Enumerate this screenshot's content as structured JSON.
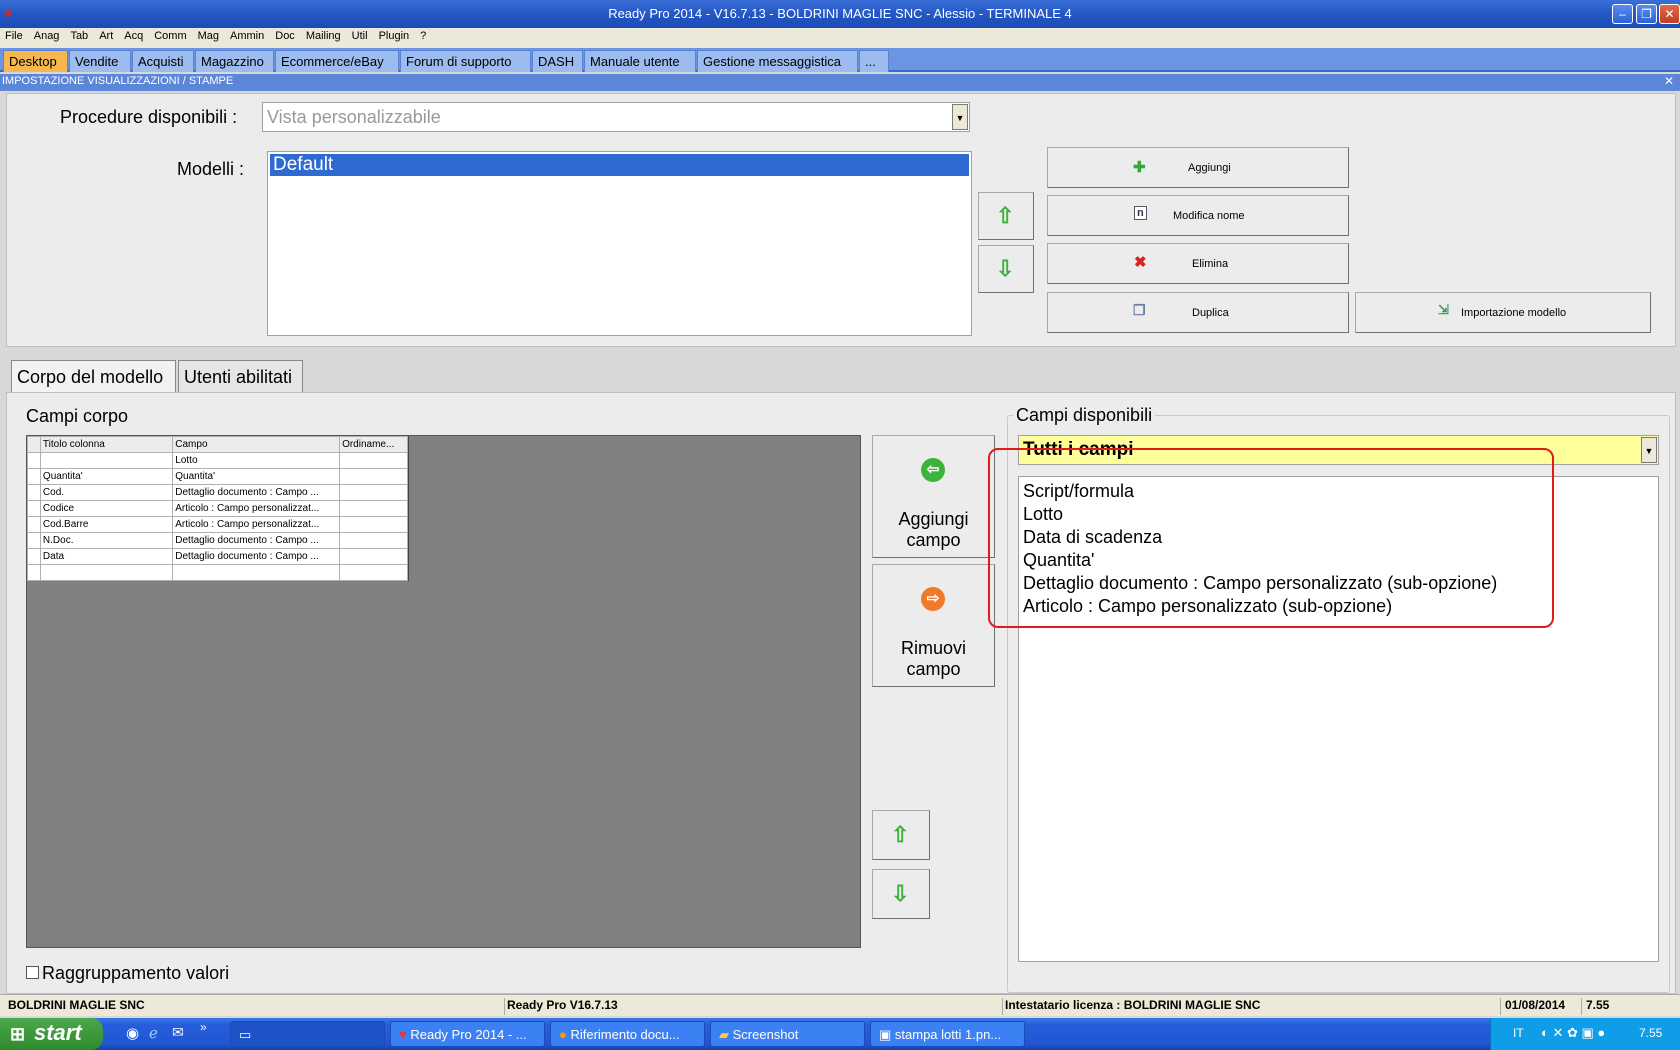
{
  "window": {
    "title": "Ready Pro 2014 - V16.7.13 - BOLDRINI MAGLIE SNC - Alessio - TERMINALE 4",
    "minimize": "–",
    "restore": "❐",
    "close": "✕"
  },
  "menu": [
    "File",
    "Anag",
    "Tab",
    "Art",
    "Acq",
    "Comm",
    "Mag",
    "Ammin",
    "Doc",
    "Mailing",
    "Util",
    "Plugin",
    "?"
  ],
  "app_tabs": [
    "Desktop",
    "Vendite",
    "Acquisti",
    "Magazzino",
    "Ecommerce/eBay",
    "Forum di supporto",
    "DASH",
    "Manuale utente",
    "Gestione messaggistica",
    "..."
  ],
  "panel": {
    "title": "IMPOSTAZIONE VISUALIZZAZIONI / STAMPE",
    "close": "✕"
  },
  "procedure": {
    "label": "Procedure disponibili :",
    "value": "Vista personalizzabile"
  },
  "modelli": {
    "label": "Modelli :",
    "items": [
      "Default"
    ]
  },
  "buttons": {
    "aggiungi": "Aggiungi",
    "modifica_nome": "Modifica nome",
    "elimina": "Elimina",
    "duplica": "Duplica",
    "importazione": "Importazione modello",
    "aggiungi_campo": "Aggiungi campo",
    "rimuovi_campo": "Rimuovi campo"
  },
  "sub_tabs": [
    "Corpo del modello",
    "Utenti abilitati"
  ],
  "campi_corpo": {
    "label": "Campi corpo",
    "columns": [
      "Titolo colonna",
      "Campo",
      "Ordiname..."
    ],
    "rows": [
      [
        "",
        "Lotto",
        ""
      ],
      [
        "Quantita'",
        "Quantita'",
        ""
      ],
      [
        "Cod.",
        "Dettaglio documento : Campo ...",
        ""
      ],
      [
        "Codice",
        "Articolo : Campo personalizzat...",
        ""
      ],
      [
        "Cod.Barre",
        "Articolo : Campo personalizzat...",
        ""
      ],
      [
        "N.Doc.",
        "Dettaglio documento : Campo ...",
        ""
      ],
      [
        "Data",
        "Dettaglio documento : Campo ...",
        ""
      ],
      [
        "",
        "",
        ""
      ]
    ]
  },
  "campi_disponibili": {
    "label": "Campi disponibili",
    "filter": "Tutti i campi",
    "items": [
      "Script/formula",
      "Lotto",
      "Data di scadenza",
      "Quantita'",
      "Dettaglio documento : Campo personalizzato (sub-opzione)",
      "Articolo : Campo personalizzato (sub-opzione)"
    ]
  },
  "raggruppamento": {
    "label": "Raggruppamento valori",
    "checked": false
  },
  "status": {
    "company": "BOLDRINI MAGLIE SNC",
    "version": "Ready Pro V16.7.13",
    "license": "Intestatario licenza : BOLDRINI MAGLIE SNC",
    "date": "01/08/2014",
    "time": "7.55"
  },
  "taskbar": {
    "start": "start",
    "tasks": [
      "Ready Pro 2014 - ...",
      "Riferimento docu...",
      "Screenshot",
      "stampa lotti 1.pn..."
    ],
    "lang": "IT",
    "clock": "7.55"
  }
}
